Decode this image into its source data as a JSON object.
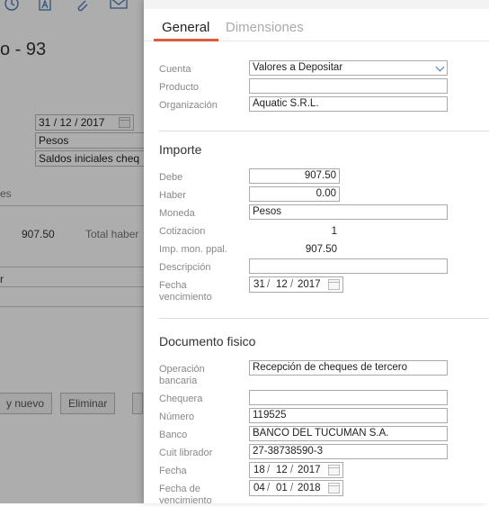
{
  "background": {
    "title": "o - 93",
    "date": {
      "d": "31",
      "m": "12",
      "y": "2017"
    },
    "currency": "Pesos",
    "type": "Saldos iniciales cheq",
    "section_label": "es",
    "total_value": "907.50",
    "total_haber_label": "Total haber",
    "field_r": "r",
    "btn_new": "y nuevo",
    "btn_delete": "Eliminar"
  },
  "tabs": {
    "general": "General",
    "dimensiones": "Dimensiones"
  },
  "form": {
    "cuenta_label": "Cuenta",
    "cuenta_value": "Valores a Depositar",
    "producto_label": "Producto",
    "producto_value": "",
    "organizacion_label": "Organización",
    "organizacion_value": "Aquatic S.R.L."
  },
  "importe": {
    "title": "Importe",
    "debe_label": "Debe",
    "debe_value": "907.50",
    "haber_label": "Haber",
    "haber_value": "0.00",
    "moneda_label": "Moneda",
    "moneda_value": "Pesos",
    "cotizacion_label": "Cotizacion",
    "cotizacion_value": "1",
    "imp_label": "Imp. mon. ppal.",
    "imp_value": "907.50",
    "descripcion_label": "Descripción",
    "descripcion_value": "",
    "fecha_venc_label_1": "Fecha",
    "fecha_venc_label_2": "vencimiento",
    "fecha_venc": {
      "d": "31",
      "m": "12",
      "y": "2017"
    }
  },
  "documento": {
    "title": "Documento fisico",
    "operacion_label_1": "Operación",
    "operacion_label_2": "bancaria",
    "operacion_value": "Recepción de cheques de tercero",
    "chequera_label": "Chequera",
    "chequera_value": "",
    "numero_label": "Número",
    "numero_value": "119525",
    "banco_label": "Banco",
    "banco_value": "BANCO DEL TUCUMAN S.A.",
    "cuit_label": "Cuit librador",
    "cuit_value": "27-38738590-3",
    "fecha_label": "Fecha",
    "fecha": {
      "d": "18",
      "m": "12",
      "y": "2017"
    },
    "fecha_venc_label_1": "Fecha de",
    "fecha_venc_label_2": "vencimiento",
    "fecha_venc": {
      "d": "04",
      "m": "01",
      "y": "2018"
    }
  }
}
